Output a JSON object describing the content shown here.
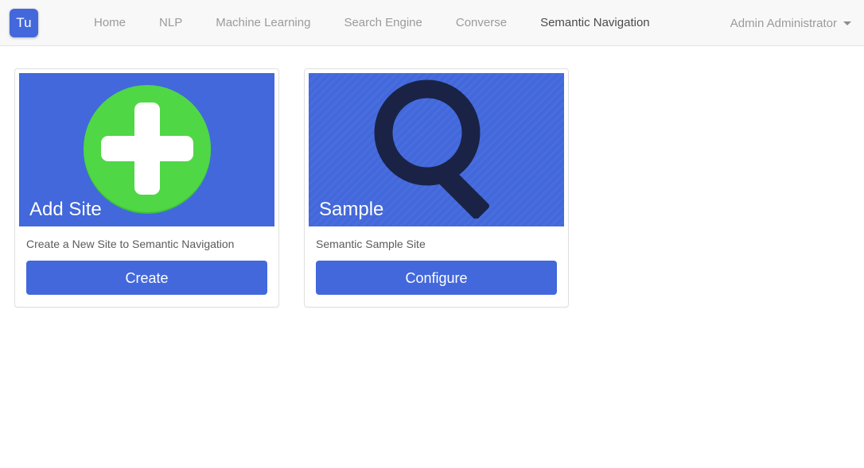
{
  "navbar": {
    "brand": "Tu",
    "brand_icon": "app-logo-icon",
    "links": [
      {
        "label": "Home",
        "active": false
      },
      {
        "label": "NLP",
        "active": false
      },
      {
        "label": "Machine Learning",
        "active": false
      },
      {
        "label": "Search Engine",
        "active": false
      },
      {
        "label": "Converse",
        "active": false
      },
      {
        "label": "Semantic Navigation",
        "active": true
      }
    ],
    "user": {
      "label": "Admin Administrator",
      "caret_icon": "chevron-down-icon"
    }
  },
  "cards": [
    {
      "title": "Add Site",
      "icon": "plus-circle-icon",
      "description": "Create a New Site to Semantic Navigation",
      "button_label": "Create"
    },
    {
      "title": "Sample",
      "icon": "magnifier-icon",
      "description": "Semantic Sample Site",
      "button_label": "Configure"
    }
  ],
  "colors": {
    "primary_blue": "#4268dc",
    "accent_green": "#4fd746",
    "icon_navy": "#1a2346",
    "navbar_bg": "#f8f8f8",
    "nav_link": "#9b9b9b",
    "nav_link_active": "#4a4a4a"
  }
}
